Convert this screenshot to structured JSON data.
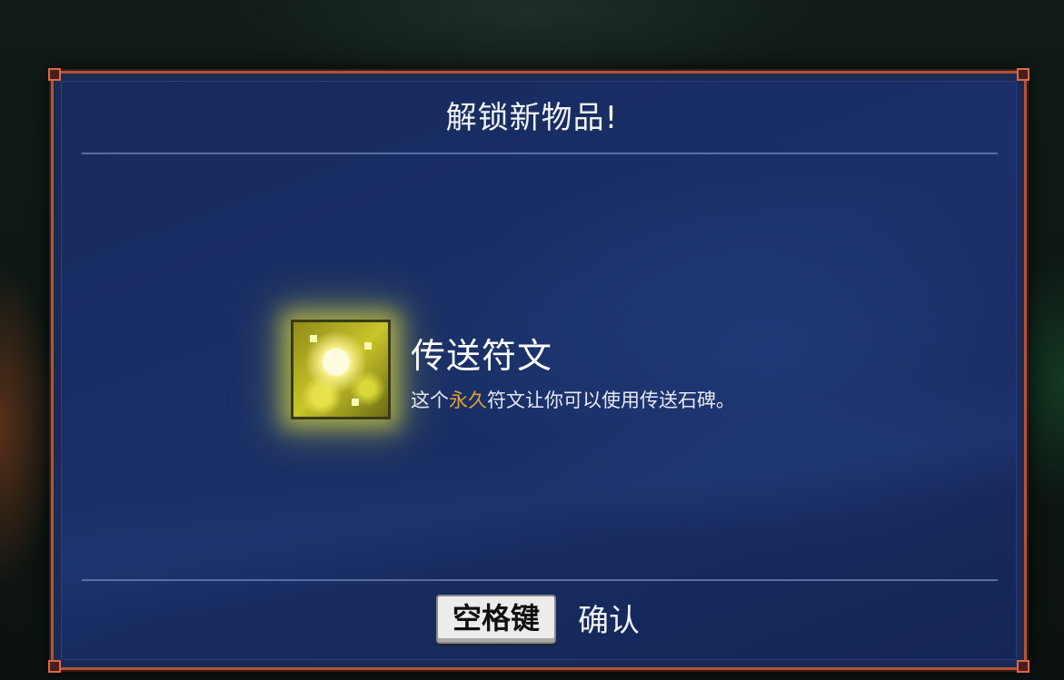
{
  "dialog": {
    "title": "解锁新物品!"
  },
  "item": {
    "icon": "teleport-rune-icon",
    "name": "传送符文",
    "description": {
      "before": "这个",
      "highlight": "永久",
      "after": "符文让你可以使用传送石碑。"
    },
    "highlight_color": "#e0a23a"
  },
  "footer": {
    "key_label": "空格键",
    "action_label": "确认"
  },
  "colors": {
    "frame_border": "#b2533a",
    "panel_bg": "#1a3068",
    "icon_glow": "#f0eb3c"
  }
}
